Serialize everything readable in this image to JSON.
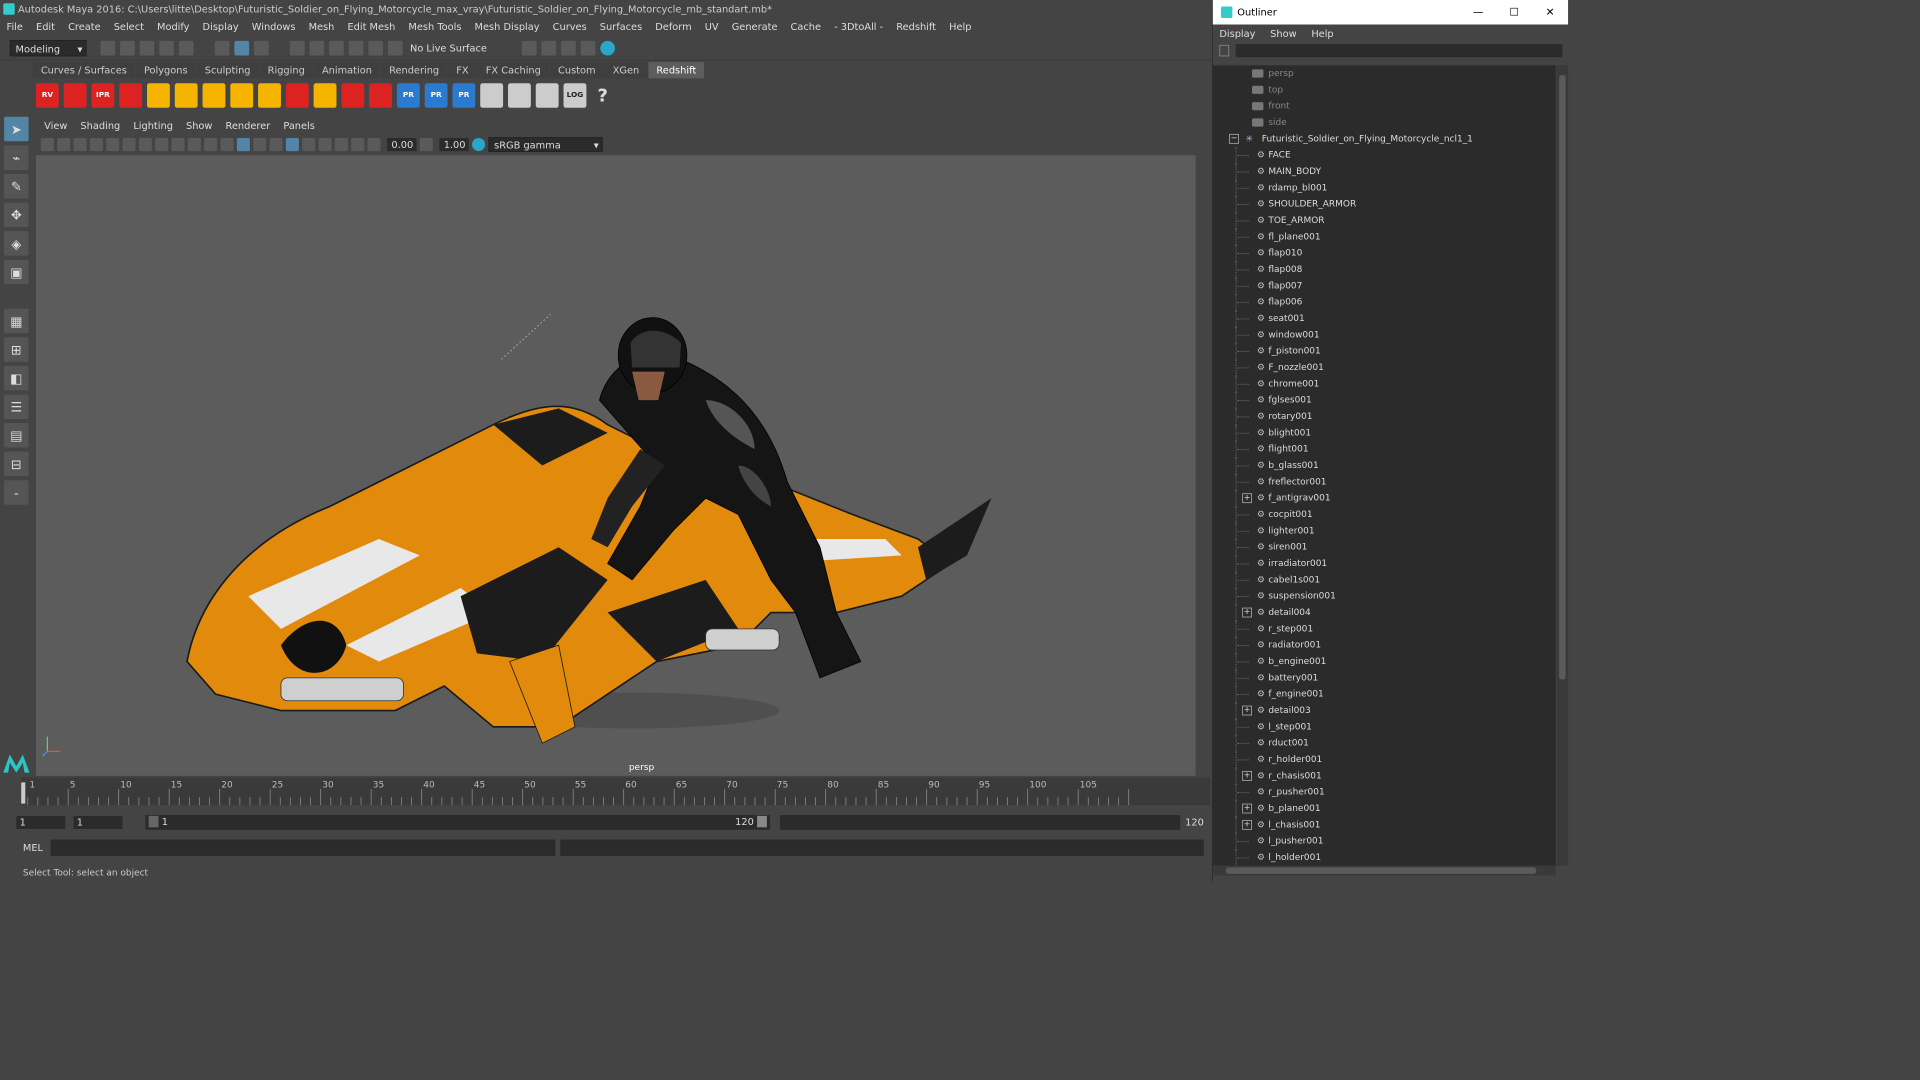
{
  "window": {
    "title": "Autodesk Maya 2016: C:\\Users\\litte\\Desktop\\Futuristic_Soldier_on_Flying_Motorcycle_max_vray\\Futuristic_Soldier_on_Flying_Motorcycle_mb_standart.mb*"
  },
  "menubar": [
    "File",
    "Edit",
    "Create",
    "Select",
    "Modify",
    "Display",
    "Windows",
    "Mesh",
    "Edit Mesh",
    "Mesh Tools",
    "Mesh Display",
    "Curves",
    "Surfaces",
    "Deform",
    "UV",
    "Generate",
    "Cache",
    "- 3DtoAll -",
    "Redshift",
    "Help"
  ],
  "statusline": {
    "mode": "Modeling",
    "live_surface": "No Live Surface"
  },
  "shelf": {
    "tabs": [
      "Curves / Surfaces",
      "Polygons",
      "Sculpting",
      "Rigging",
      "Animation",
      "Rendering",
      "FX",
      "FX Caching",
      "Custom",
      "XGen",
      "Redshift"
    ],
    "active_tab": "Redshift",
    "icons": [
      {
        "label": "RV",
        "color": "#d22"
      },
      {
        "label": "",
        "color": "#d22"
      },
      {
        "label": "IPR",
        "color": "#d22"
      },
      {
        "label": "",
        "color": "#d22"
      },
      {
        "label": "",
        "color": "#f5b400"
      },
      {
        "label": "",
        "color": "#f5b400"
      },
      {
        "label": "",
        "color": "#f5b400"
      },
      {
        "label": "",
        "color": "#f5b400"
      },
      {
        "label": "",
        "color": "#f5b400"
      },
      {
        "label": "",
        "color": "#d22"
      },
      {
        "label": "",
        "color": "#f5b400"
      },
      {
        "label": "",
        "color": "#d22"
      },
      {
        "label": "",
        "color": "#d22"
      },
      {
        "label": "PR",
        "color": "#2a7bd0"
      },
      {
        "label": "PR",
        "color": "#2a7bd0"
      },
      {
        "label": "PR",
        "color": "#2a7bd0"
      },
      {
        "label": "",
        "color": "#ccc"
      },
      {
        "label": "",
        "color": "#ccc"
      },
      {
        "label": "",
        "color": "#ccc"
      },
      {
        "label": "LOG",
        "color": "#ccc"
      },
      {
        "label": "?",
        "color": "#444"
      }
    ]
  },
  "panel": {
    "menu": [
      "View",
      "Shading",
      "Lighting",
      "Show",
      "Renderer",
      "Panels"
    ],
    "field1": "0.00",
    "field2": "1.00",
    "colorspace": "sRGB gamma",
    "camera_label": "persp"
  },
  "timeline": {
    "ticks": [
      "1",
      "5",
      "10",
      "15",
      "20",
      "25",
      "30",
      "35",
      "40",
      "45",
      "50",
      "55",
      "60",
      "65",
      "70",
      "75",
      "80",
      "85",
      "90",
      "95",
      "100",
      "105"
    ]
  },
  "range": {
    "start": "1",
    "current": "1",
    "slider_start": "1",
    "slider_end": "120",
    "end": "120"
  },
  "cmdline": {
    "label": "MEL"
  },
  "help": {
    "text": "Select Tool: select an object"
  },
  "outliner": {
    "title": "Outliner",
    "menu": [
      "Display",
      "Show",
      "Help"
    ],
    "cameras": [
      "persp",
      "top",
      "front",
      "side"
    ],
    "root": "Futuristic_Soldier_on_Flying_Motorcycle_ncl1_1",
    "items": [
      {
        "name": "FACE",
        "expand": false
      },
      {
        "name": "MAIN_BODY",
        "expand": false
      },
      {
        "name": "rdamp_bl001",
        "expand": false
      },
      {
        "name": "SHOULDER_ARMOR",
        "expand": false
      },
      {
        "name": "TOE_ARMOR",
        "expand": false
      },
      {
        "name": "fl_plane001",
        "expand": false
      },
      {
        "name": "flap010",
        "expand": false
      },
      {
        "name": "flap008",
        "expand": false
      },
      {
        "name": "flap007",
        "expand": false
      },
      {
        "name": "flap006",
        "expand": false
      },
      {
        "name": "seat001",
        "expand": false
      },
      {
        "name": "window001",
        "expand": false
      },
      {
        "name": "f_piston001",
        "expand": false
      },
      {
        "name": "F_nozzle001",
        "expand": false
      },
      {
        "name": "chrome001",
        "expand": false
      },
      {
        "name": "fglses001",
        "expand": false
      },
      {
        "name": "rotary001",
        "expand": false
      },
      {
        "name": "blight001",
        "expand": false
      },
      {
        "name": "flight001",
        "expand": false
      },
      {
        "name": "b_glass001",
        "expand": false
      },
      {
        "name": "freflector001",
        "expand": false
      },
      {
        "name": "f_antigrav001",
        "expand": true
      },
      {
        "name": "cocpit001",
        "expand": false
      },
      {
        "name": "lighter001",
        "expand": false
      },
      {
        "name": "siren001",
        "expand": false
      },
      {
        "name": "irradiator001",
        "expand": false
      },
      {
        "name": "cabel1s001",
        "expand": false
      },
      {
        "name": "suspension001",
        "expand": false
      },
      {
        "name": "detail004",
        "expand": true
      },
      {
        "name": "r_step001",
        "expand": false
      },
      {
        "name": "radiator001",
        "expand": false
      },
      {
        "name": "b_engine001",
        "expand": false
      },
      {
        "name": "battery001",
        "expand": false
      },
      {
        "name": "f_engine001",
        "expand": false
      },
      {
        "name": "detail003",
        "expand": true
      },
      {
        "name": "l_step001",
        "expand": false
      },
      {
        "name": "rduct001",
        "expand": false
      },
      {
        "name": "r_holder001",
        "expand": false
      },
      {
        "name": "r_chasis001",
        "expand": true
      },
      {
        "name": "r_pusher001",
        "expand": false
      },
      {
        "name": "b_plane001",
        "expand": true
      },
      {
        "name": "l_chasis001",
        "expand": true
      },
      {
        "name": "l_pusher001",
        "expand": false
      },
      {
        "name": "l_holder001",
        "expand": false
      }
    ]
  }
}
